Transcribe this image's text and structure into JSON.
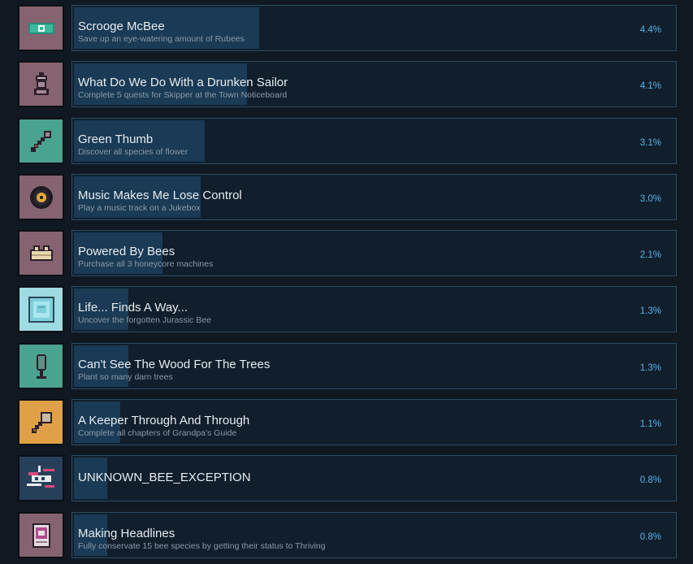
{
  "achievements": [
    {
      "title": "Scrooge McBee",
      "desc": "Save up an eye-watering amount of Rubees",
      "percent": "4.4%",
      "progress": 0.044,
      "icon": "rubee-note-icon",
      "icon_bg": "#866370"
    },
    {
      "title": "What Do We Do With a Drunken Sailor",
      "desc": "Complete 5 quests for Skipper at the Town Noticeboard",
      "percent": "4.1%",
      "progress": 0.041,
      "icon": "sailor-icon",
      "icon_bg": "#866370"
    },
    {
      "title": "Green Thumb",
      "desc": "Discover all species of flower",
      "percent": "3.1%",
      "progress": 0.031,
      "icon": "trowel-icon",
      "icon_bg": "#4aa38f"
    },
    {
      "title": "Music Makes Me Lose Control",
      "desc": "Play a music track on a Jukebox",
      "percent": "3.0%",
      "progress": 0.03,
      "icon": "vinyl-record-icon",
      "icon_bg": "#866370"
    },
    {
      "title": "Powered By Bees",
      "desc": "Purchase all 3 honeycore machines",
      "percent": "2.1%",
      "progress": 0.021,
      "icon": "machine-icon",
      "icon_bg": "#866370"
    },
    {
      "title": "Life... Finds A Way...",
      "desc": "Uncover the forgotten Jurassic Bee",
      "percent": "1.3%",
      "progress": 0.013,
      "icon": "amber-fossil-icon",
      "icon_bg": "#9fdbe3"
    },
    {
      "title": "Can't See The Wood For The Trees",
      "desc": "Plant so many darn trees",
      "percent": "1.3%",
      "progress": 0.013,
      "icon": "sapling-icon",
      "icon_bg": "#4aa38f"
    },
    {
      "title": "A Keeper Through And Through",
      "desc": "Complete all chapters of Grandpa's Guide",
      "percent": "1.1%",
      "progress": 0.011,
      "icon": "axe-icon",
      "icon_bg": "#e0a046"
    },
    {
      "title": "UNKNOWN_BEE_EXCEPTION",
      "desc": "",
      "percent": "0.8%",
      "progress": 0.008,
      "icon": "glitch-bee-icon",
      "icon_bg": "#27405a"
    },
    {
      "title": "Making Headlines",
      "desc": "Fully conservate 15 bee species by getting their status to Thriving",
      "percent": "0.8%",
      "progress": 0.008,
      "icon": "newspaper-icon",
      "icon_bg": "#866370"
    }
  ]
}
